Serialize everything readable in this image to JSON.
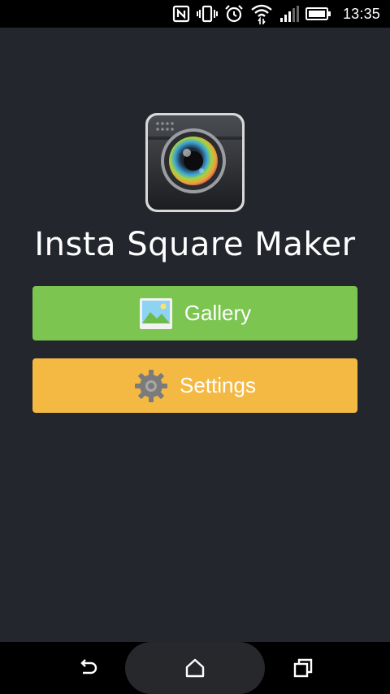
{
  "status_bar": {
    "time": "13:35",
    "icons": [
      "nfc-icon",
      "vibrate-icon",
      "alarm-icon",
      "wifi-icon",
      "signal-icon",
      "battery-icon"
    ]
  },
  "app": {
    "title": "Insta Square Maker",
    "icon": "camera-lens-icon"
  },
  "buttons": {
    "gallery_label": "Gallery",
    "gallery_icon": "gallery-picture-icon",
    "settings_label": "Settings",
    "settings_icon": "gear-icon"
  },
  "colors": {
    "background": "#23262c",
    "gallery": "#7cc551",
    "settings": "#f4b942"
  },
  "nav_bar": {
    "icons": [
      "back-icon",
      "home-icon",
      "recents-icon"
    ]
  }
}
